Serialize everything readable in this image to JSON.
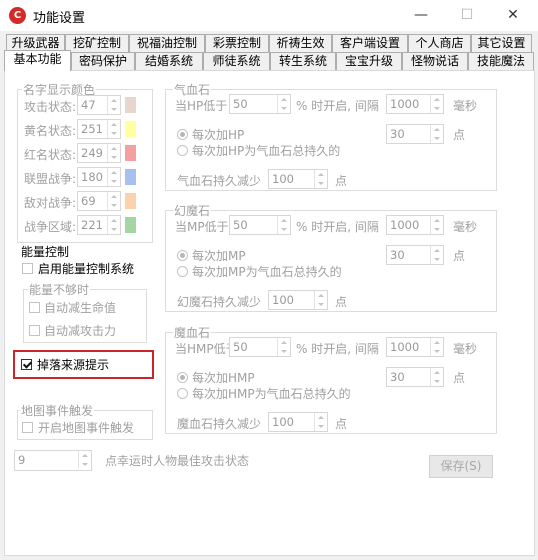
{
  "window": {
    "title": "功能设置",
    "icon_glyph": "C",
    "minimize": "—",
    "maximize": "☐",
    "close": "✕"
  },
  "tabs_row1": [
    "升级武器",
    "挖矿控制",
    "祝福油控制",
    "彩票控制",
    "祈祷生效",
    "客户端设置",
    "个人商店",
    "其它设置"
  ],
  "tabs_row2": [
    "基本功能",
    "密码保护",
    "结婚系统",
    "师徒系统",
    "转生系统",
    "宝宝升级",
    "怪物说话",
    "技能魔法"
  ],
  "active_tab": "基本功能",
  "name_colors": {
    "title": "名字显示颜色",
    "rows": [
      {
        "label": "攻击状态:",
        "value": "47",
        "color": "#e7d6cc"
      },
      {
        "label": "黄名状态:",
        "value": "251",
        "color": "#ffffa0"
      },
      {
        "label": "红名状态:",
        "value": "249",
        "color": "#f5a0a0"
      },
      {
        "label": "联盟战争:",
        "value": "180",
        "color": "#a8bff2"
      },
      {
        "label": "敌对战争:",
        "value": "69",
        "color": "#fbd1ae"
      },
      {
        "label": "战争区域:",
        "value": "221",
        "color": "#a4d6a4"
      }
    ]
  },
  "energy": {
    "title": "能量控制",
    "enable_label": "启用能量控制系统",
    "insufficient": {
      "title": "能量不够时",
      "auto_hp_label": "自动减生命值",
      "auto_attack_label": "自动减攻击力"
    }
  },
  "drop_hint": {
    "label": "掉落来源提示",
    "checked": true
  },
  "map_event": {
    "title": "地图事件触发",
    "enable_label": "开启地图事件触发"
  },
  "lucky": {
    "value": "9",
    "label": "点幸运时人物最佳攻击状态"
  },
  "save_button": "保存(S)",
  "stones": [
    {
      "title": "气血石",
      "low_label": "当HP低于",
      "low_value": "50",
      "open_label": "% 时开启, 间隔",
      "interval_value": "1000",
      "interval_unit": "毫秒",
      "each_label": "每次加HP",
      "each_value": "30",
      "each_unit": "点",
      "total_label": "每次加HP为气血石总持久的",
      "reduce_label": "气血石持久减少",
      "reduce_value": "100",
      "reduce_unit": "点"
    },
    {
      "title": "幻魔石",
      "low_label": "当MP低于",
      "low_value": "50",
      "open_label": "% 时开启, 间隔",
      "interval_value": "1000",
      "interval_unit": "毫秒",
      "each_label": "每次加MP",
      "each_value": "30",
      "each_unit": "点",
      "total_label": "每次加MP为气血石总持久的",
      "reduce_label": "幻魔石持久减少",
      "reduce_value": "100",
      "reduce_unit": "点"
    },
    {
      "title": "魔血石",
      "low_label": "当HMP低于",
      "low_value": "50",
      "open_label": "% 时开启, 间隔",
      "interval_value": "1000",
      "interval_unit": "毫秒",
      "each_label": "每次加HMP",
      "each_value": "30",
      "each_unit": "点",
      "total_label": "每次加HMP为气血石总持久的",
      "reduce_label": "魔血石持久减少",
      "reduce_value": "100",
      "reduce_unit": "点"
    }
  ]
}
